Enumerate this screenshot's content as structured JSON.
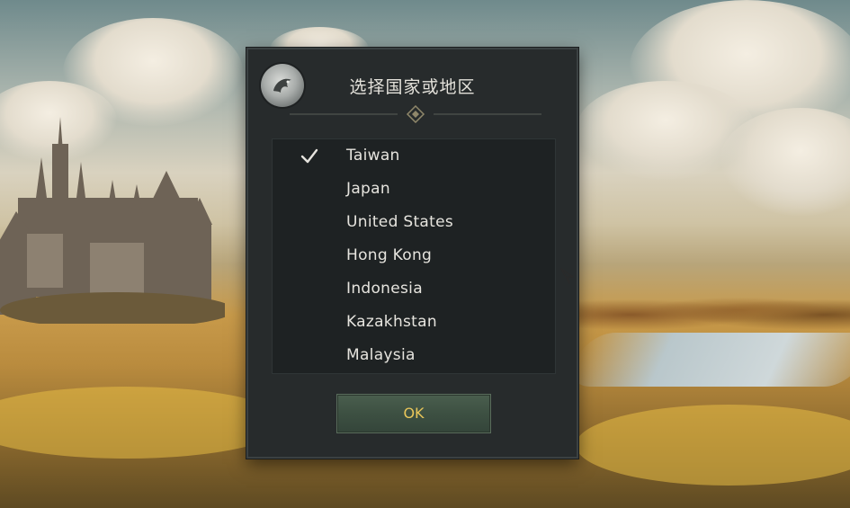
{
  "dialog": {
    "title": "选择国家或地区",
    "selected_index": 0,
    "countries": [
      {
        "label": "Taiwan",
        "selected": true
      },
      {
        "label": "Japan",
        "selected": false
      },
      {
        "label": "United States",
        "selected": false
      },
      {
        "label": "Hong Kong",
        "selected": false
      },
      {
        "label": "Indonesia",
        "selected": false
      },
      {
        "label": "Kazakhstan",
        "selected": false
      },
      {
        "label": "Malaysia",
        "selected": false
      }
    ],
    "ok_label": "OK"
  },
  "colors": {
    "ok_text": "#e9c65a",
    "dialog_bg": "#272b2c",
    "list_bg": "#1e2223"
  },
  "icons": {
    "emblem": "dragon-emblem-icon",
    "check": "checkmark-icon",
    "ornament": "diamond-divider-icon",
    "cursor": "arrow-cursor-icon"
  }
}
